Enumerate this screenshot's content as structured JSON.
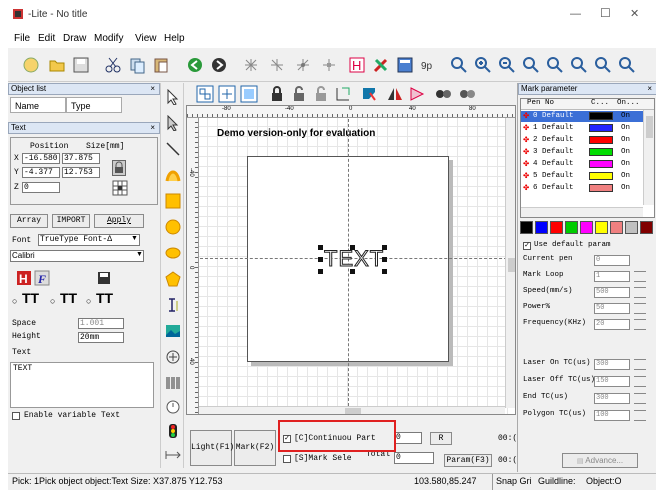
{
  "window": {
    "title": "-Lite - No title",
    "min": "—",
    "max": "☐",
    "close": "✕"
  },
  "menu": [
    "File",
    "Edit",
    "Draw",
    "Modify",
    "View",
    "Help"
  ],
  "object_list": {
    "title": "Object list",
    "close": "×",
    "col_name": "Name",
    "col_type": "Type"
  },
  "text_panel": {
    "title": "Text",
    "close": "×",
    "position_hdr": "Position",
    "size_hdr": "Size[mm]",
    "x_label": "X",
    "x_pos": "-16.580",
    "x_size": "37.875",
    "y_label": "Y",
    "y_pos": "-4.377",
    "y_size": "12.753",
    "z_label": "Z",
    "z_pos": "0",
    "array_btn": "Array",
    "import_btn": "IMPORT",
    "apply_btn": "Apply",
    "font_label": "Font",
    "font_type": "TrueType Font-Δ",
    "font_name": "Calibri",
    "space_label": "Space",
    "space_val": "1.001",
    "height_label": "Height",
    "height_val": "20mm",
    "text_label": "Text",
    "text_val": "TEXT",
    "variable_label": "Enable variable Text"
  },
  "canvas": {
    "watermark": "Demo version-only for evaluation",
    "object_text": "TEXT",
    "ruler_labels": [
      "-80",
      "-40",
      "0",
      "40",
      "80",
      "-40",
      "0",
      "40"
    ]
  },
  "bottom": {
    "light_btn": "Light(F1)",
    "mark_btn": "Mark(F2)",
    "continuous_label": "[C]Continuou Part",
    "continuous_val": "0",
    "r_btn": "R",
    "time1": "00:(",
    "sel_label": "[S]Mark Sele",
    "total_label": "Total",
    "total_val": "0",
    "param_btn": "Param(F3)",
    "time2": "00:("
  },
  "mark_param": {
    "title": "Mark parameter",
    "close": "×",
    "col_pen": "Pen No",
    "col_c": "C...",
    "col_on": "On...",
    "pens": [
      {
        "label": "0 Default",
        "color": "#000000",
        "on": "On"
      },
      {
        "label": "1 Default",
        "color": "#2323ff",
        "on": "On"
      },
      {
        "label": "2 Default",
        "color": "#ff0000",
        "on": "On"
      },
      {
        "label": "3 Default",
        "color": "#00dd00",
        "on": "On"
      },
      {
        "label": "4 Default",
        "color": "#ff00ff",
        "on": "On"
      },
      {
        "label": "5 Default",
        "color": "#ffff00",
        "on": "On"
      },
      {
        "label": "6 Default",
        "color": "#f08080",
        "on": "On"
      }
    ],
    "swatches": [
      "#000000",
      "#0000ff",
      "#ff0000",
      "#00cc00",
      "#ff00ff",
      "#ffff00",
      "#f08080",
      "#c0c0c0",
      "#800000"
    ],
    "use_default": "Use default param",
    "params": [
      {
        "label": "Current pen",
        "value": "0",
        "spin": false
      },
      {
        "label": "Mark Loop",
        "value": "1",
        "spin": true
      },
      {
        "label": "Speed(mm/s)",
        "value": "500",
        "spin": true
      },
      {
        "label": "Power%",
        "value": "50",
        "spin": true
      },
      {
        "label": "Frequency(KHz)",
        "value": "20",
        "spin": true
      }
    ],
    "timing": [
      {
        "label": "Laser On TC(us)",
        "value": "300"
      },
      {
        "label": "Laser Off TC(us)",
        "value": "150"
      },
      {
        "label": "End TC(us)",
        "value": "300"
      },
      {
        "label": "Polygon TC(us)",
        "value": "100"
      }
    ],
    "advance_btn": "Advance..."
  },
  "status": {
    "pick": "Pick: 1Pick object object:Text Size: X37.875 Y12.753",
    "coords": "103.580,85.247",
    "snap": "Snap Gri",
    "guide": "Guildline:",
    "obj": "Object:O"
  },
  "colors": {
    "highlight_box": "#e02020",
    "panel_header": "#dce6f4"
  }
}
